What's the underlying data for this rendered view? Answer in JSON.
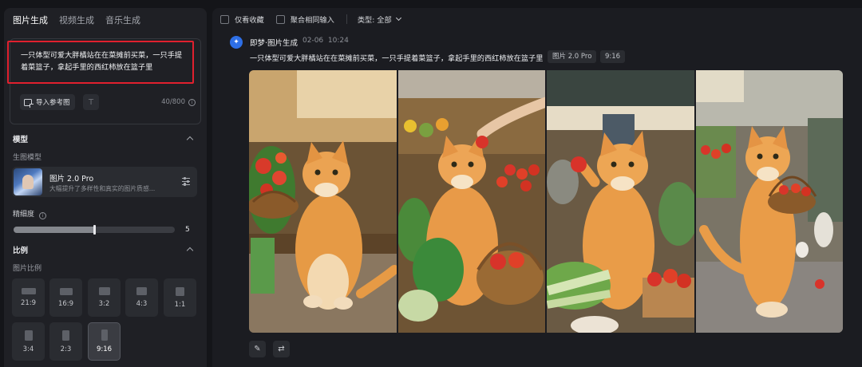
{
  "tabs": [
    {
      "label": "图片生成",
      "active": true
    },
    {
      "label": "视频生成",
      "active": false
    },
    {
      "label": "音乐生成",
      "active": false
    }
  ],
  "prompt": {
    "text": "一只体型可爱大胖橘站在在菜摊前买菜，一只手提着菜篮子，拿起手里的西红柿放在篮子里",
    "ref_button": "导入参考图",
    "counter": "40/800"
  },
  "model_section": {
    "title": "模型",
    "sub_label": "生图模型",
    "name": "图片 2.0 Pro",
    "desc": "大幅提升了多样性和真实的图片质感..."
  },
  "precision": {
    "label": "精细度",
    "value": "5",
    "fraction": 0.5
  },
  "ratio_section": {
    "title": "比例",
    "sub_label": "图片比例",
    "options": [
      "21:9",
      "16:9",
      "3:2",
      "4:3",
      "1:1",
      "3:4",
      "2:3",
      "9:16"
    ],
    "selected": "9:16"
  },
  "toolbar": {
    "favorites_only": "仅看收藏",
    "merge_inputs": "聚合相同输入",
    "type_filter": "类型: 全部"
  },
  "generation": {
    "title": "即梦·图片生成",
    "date": "02-06",
    "time": "10:24",
    "prompt": "一只体型可爱大胖橘站在在菜摊前买菜，一只手提着菜篮子，拿起手里的西红柿放在篮子里",
    "model_tag": "图片 2.0 Pro",
    "ratio_tag": "9:16"
  },
  "colors": {
    "accent_blue": "#2e6fe6",
    "highlight_red": "#e0202e",
    "panel_bg": "#1f2025",
    "app_bg": "#141519"
  },
  "icons": [
    "image-import-icon",
    "text-icon",
    "info-icon",
    "settings-sliders-icon",
    "chevron-up-icon",
    "chevron-down-icon",
    "jimeng-logo-icon",
    "edit-icon",
    "regenerate-icon"
  ]
}
